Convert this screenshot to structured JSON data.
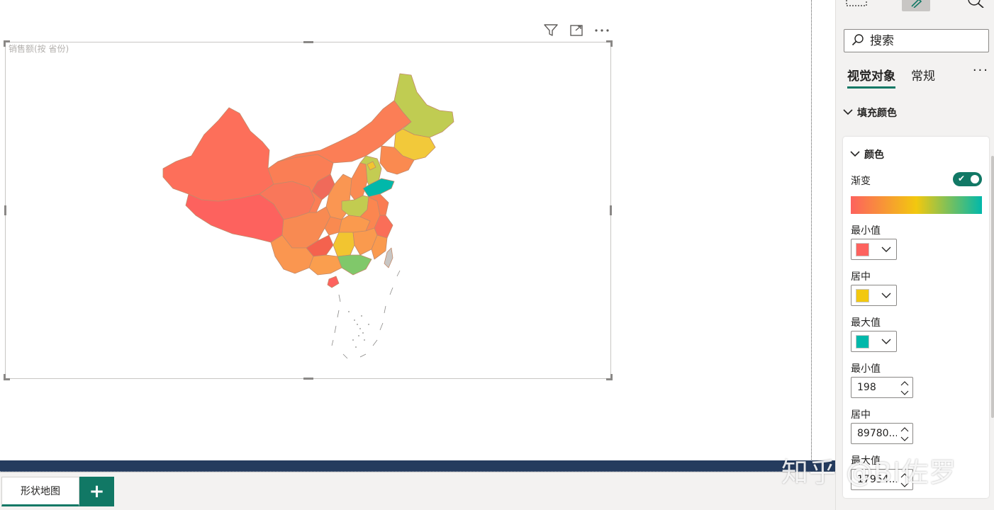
{
  "visual": {
    "title": "销售额(按 省份)",
    "toolbar": {
      "filter_icon": "filter-icon",
      "focus_icon": "focus-mode-icon",
      "more_icon": "more-options-icon"
    }
  },
  "page_tabs": {
    "active_tab": "形状地图",
    "add_label": "+"
  },
  "pane": {
    "search_placeholder": "搜索",
    "tabs": {
      "visual": "视觉对象",
      "general": "常规"
    },
    "more_label": "···",
    "section_fill": "填充颜色",
    "color_card": {
      "header": "颜色",
      "gradient_label": "渐变",
      "gradient_on": true,
      "min_color_label": "最小值",
      "mid_color_label": "居中",
      "max_color_label": "最大值",
      "min_value_label": "最小值",
      "mid_value_label": "居中",
      "max_value_label": "最大值",
      "min_value": "198",
      "mid_value": "89780...",
      "max_value": "17954..."
    }
  },
  "colors": {
    "min": "#fd625e",
    "mid": "#f2c80f",
    "max": "#01b8aa",
    "accent": "#117865",
    "bar": "#243b5e"
  },
  "watermark": "知乎 @BI佐罗"
}
